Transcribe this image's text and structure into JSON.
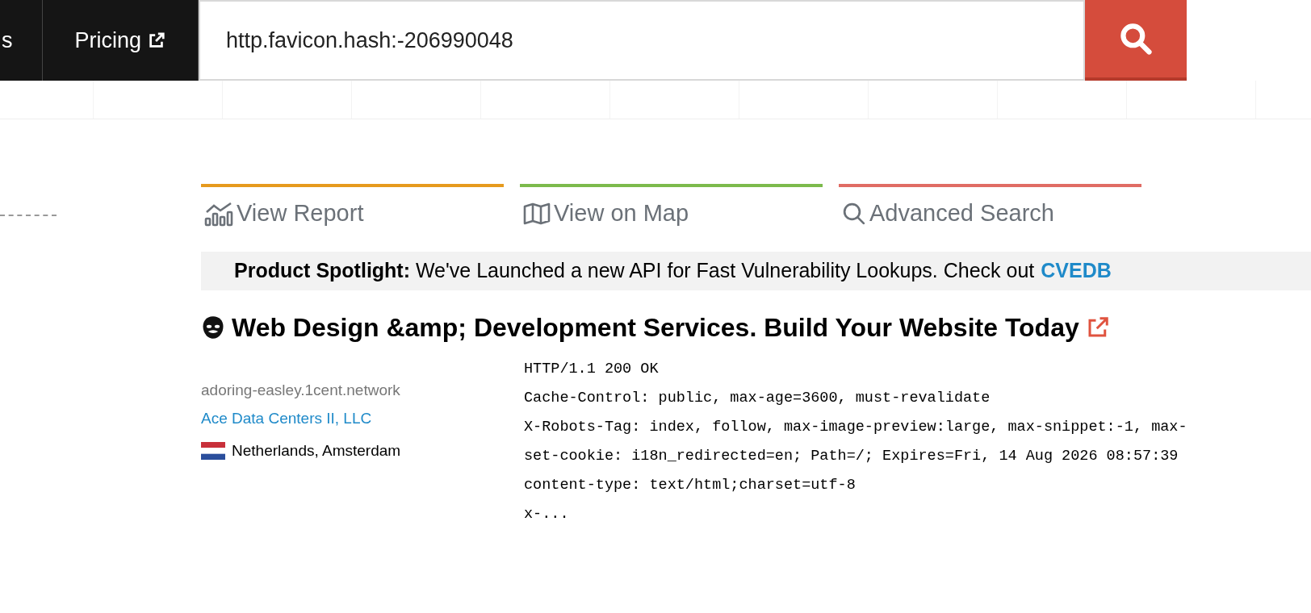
{
  "nav": {
    "items": [
      {
        "label": "s",
        "external": false
      },
      {
        "label": "Pricing",
        "external": true
      }
    ]
  },
  "search": {
    "value": "http.favicon.hash:-206990048"
  },
  "actions": [
    {
      "kind": "report",
      "label": "View Report",
      "color": "#e69a1e"
    },
    {
      "kind": "map",
      "label": "View on Map",
      "color": "#7cba4c"
    },
    {
      "kind": "search",
      "label": "Advanced Search",
      "color": "#e06c64"
    }
  ],
  "spotlight": {
    "text": "**Product Spotlight:** We've Launched a new API for Fast Vulnerability Lookups. Check out",
    "link": "CVEDB"
  },
  "result": {
    "title": "Web Design &amp; Development Services. Build Your Website Today",
    "hostname": "adoring-easley.1cent.network",
    "org": "Ace Data Centers II, LLC",
    "location": "Netherlands, Amsterdam",
    "headers": [
      "HTTP/1.1 200 OK",
      "Cache-Control: public, max-age=3600, must-revalidate",
      "X-Robots-Tag: index, follow, max-image-preview:large, max-snippet:-1, max-",
      "set-cookie: i18n_redirected=en; Path=/; Expires=Fri, 14 Aug 2026 08:57:39",
      "content-type: text/html;charset=utf-8",
      "x-..."
    ]
  }
}
